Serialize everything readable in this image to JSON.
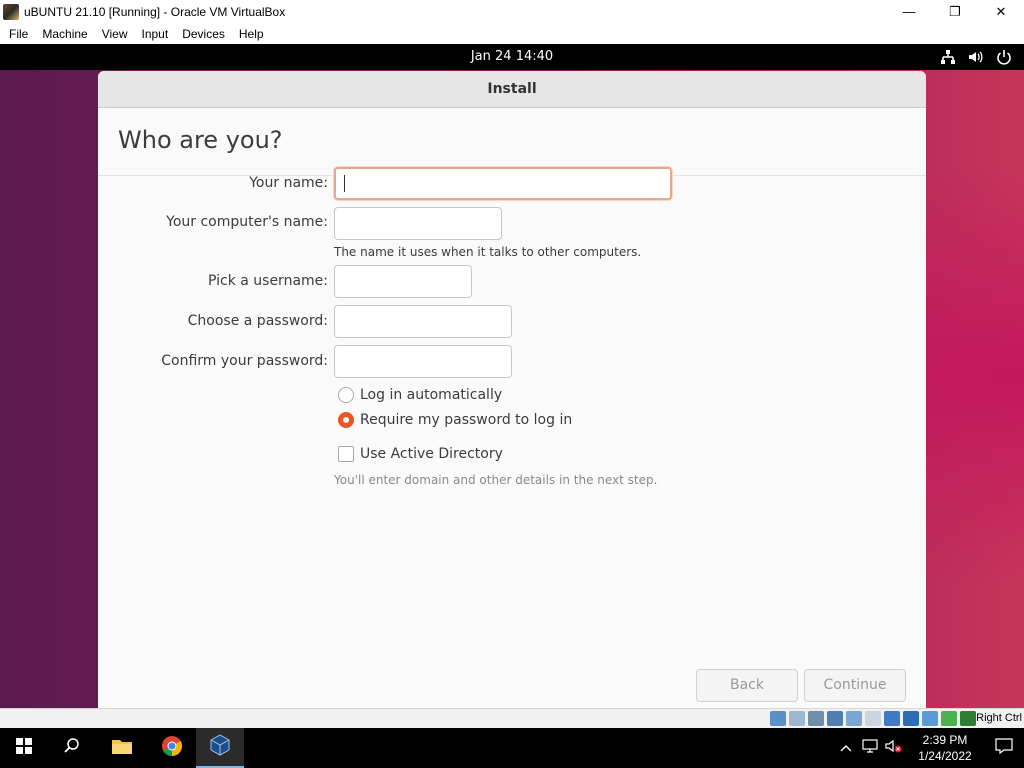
{
  "host": {
    "title": "uBUNTU 21.10 [Running] - Oracle VM VirtualBox",
    "menu": [
      "File",
      "Machine",
      "View",
      "Input",
      "Devices",
      "Help"
    ],
    "controls": {
      "minimize": "—",
      "maximize": "❐",
      "close": "✕"
    }
  },
  "guest": {
    "clock": "Jan 24  14:40",
    "status_icons": [
      "network-icon",
      "volume-icon",
      "power-icon"
    ]
  },
  "installer": {
    "window_title": "Install",
    "heading": "Who are you?",
    "fields": {
      "name_label": "Your name:",
      "name_value": "",
      "computer_label": "Your computer's name:",
      "computer_value": "",
      "computer_hint": "The name it uses when it talks to other computers.",
      "username_label": "Pick a username:",
      "username_value": "",
      "password_label": "Choose a password:",
      "password_value": "",
      "confirm_label": "Confirm your password:",
      "confirm_value": ""
    },
    "options": {
      "auto_login": "Log in automatically",
      "require_password": "Require my password to log in",
      "selected": "require_password",
      "active_directory": "Use Active Directory",
      "active_directory_checked": false,
      "active_directory_hint": "You'll enter domain and other details in the next step."
    },
    "buttons": {
      "back": "Back",
      "continue": "Continue"
    }
  },
  "vbox_status": {
    "host_key": "Right Ctrl"
  },
  "taskbar": {
    "time": "2:39 PM",
    "date": "1/24/2022",
    "pinned": [
      "start-icon",
      "search-icon",
      "file-explorer-icon",
      "chrome-icon",
      "virtualbox-icon"
    ]
  },
  "colors": {
    "accent": "#e95420",
    "guest_bg": "#7a1f57",
    "taskbar": "#000000"
  }
}
